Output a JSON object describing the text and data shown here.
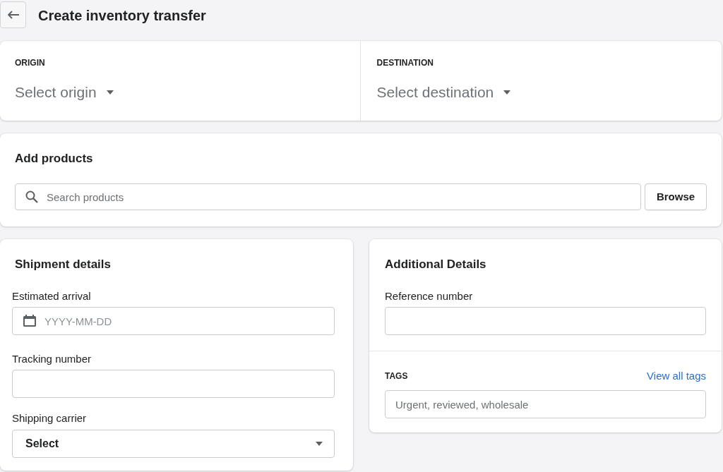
{
  "header": {
    "title": "Create inventory transfer"
  },
  "locations": [
    {
      "label": "ORIGIN",
      "placeholder": "Select origin"
    },
    {
      "label": "DESTINATION",
      "placeholder": "Select destination"
    }
  ],
  "add_products": {
    "title": "Add products",
    "search": {
      "placeholder": "Search products"
    },
    "browse_button": "Browse"
  },
  "shipment_details": {
    "title": "Shipment details",
    "fields": [
      {
        "kind": "date",
        "label": "Estimated arrival",
        "placeholder": "YYYY-MM-DD"
      },
      {
        "kind": "text",
        "label": "Tracking number"
      },
      {
        "kind": "select",
        "label": "Shipping carrier",
        "value": "Select"
      }
    ]
  },
  "additional_details": {
    "title": "Additional Details",
    "reference": {
      "label": "Reference number"
    },
    "tags": {
      "label": "TAGS",
      "link": "View all tags",
      "placeholder": "Urgent, reviewed, wholesale"
    }
  }
}
